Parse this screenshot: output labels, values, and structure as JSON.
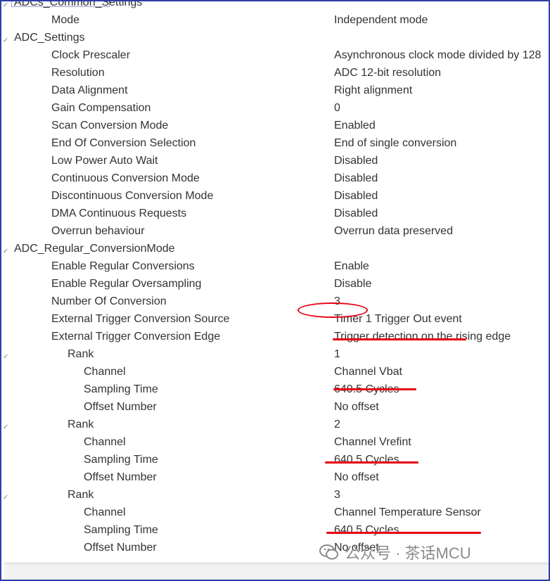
{
  "accent_colors": {
    "border": "#2f3fa8",
    "annotation": "#e60012"
  },
  "rows": [
    {
      "key": "ADCs_Common_Settings",
      "val": "",
      "level": 0,
      "chev": true
    },
    {
      "key": "Mode",
      "val": "Independent mode",
      "level": 1,
      "chev": false
    },
    {
      "key": "ADC_Settings",
      "val": "",
      "level": 0,
      "chev": true
    },
    {
      "key": "Clock Prescaler",
      "val": "Asynchronous clock mode divided by 128",
      "level": 1,
      "chev": false
    },
    {
      "key": "Resolution",
      "val": "ADC 12-bit resolution",
      "level": 1,
      "chev": false
    },
    {
      "key": "Data Alignment",
      "val": "Right alignment",
      "level": 1,
      "chev": false
    },
    {
      "key": "Gain Compensation",
      "val": "0",
      "level": 1,
      "chev": false
    },
    {
      "key": "Scan Conversion Mode",
      "val": "Enabled",
      "level": 1,
      "chev": false
    },
    {
      "key": "End Of Conversion Selection",
      "val": "End of single conversion",
      "level": 1,
      "chev": false
    },
    {
      "key": "Low Power Auto Wait",
      "val": "Disabled",
      "level": 1,
      "chev": false
    },
    {
      "key": "Continuous Conversion Mode",
      "val": "Disabled",
      "level": 1,
      "chev": false
    },
    {
      "key": "Discontinuous Conversion Mode",
      "val": "Disabled",
      "level": 1,
      "chev": false
    },
    {
      "key": "DMA Continuous Requests",
      "val": "Disabled",
      "level": 1,
      "chev": false
    },
    {
      "key": "Overrun behaviour",
      "val": "Overrun data preserved",
      "level": 1,
      "chev": false
    },
    {
      "key": "ADC_Regular_ConversionMode",
      "val": "",
      "level": 0,
      "chev": true
    },
    {
      "key": "Enable Regular Conversions",
      "val": "Enable",
      "level": 1,
      "chev": false
    },
    {
      "key": "Enable Regular Oversampling",
      "val": "Disable",
      "level": 1,
      "chev": false
    },
    {
      "key": "Number Of Conversion",
      "val": "3",
      "level": 1,
      "chev": false
    },
    {
      "key": "External Trigger Conversion Source",
      "val": "Timer 1 Trigger Out event",
      "level": 1,
      "chev": false
    },
    {
      "key": "External Trigger Conversion Edge",
      "val": "Trigger detection on the rising edge",
      "level": 1,
      "chev": false
    },
    {
      "key": "Rank",
      "val": "1",
      "level": 2,
      "chev": true
    },
    {
      "key": "Channel",
      "val": "Channel Vbat",
      "level": 3,
      "chev": false
    },
    {
      "key": "Sampling Time",
      "val": "640.5 Cycles",
      "level": 3,
      "chev": false
    },
    {
      "key": "Offset Number",
      "val": "No offset",
      "level": 3,
      "chev": false
    },
    {
      "key": "Rank",
      "val": "2",
      "level": 2,
      "chev": true
    },
    {
      "key": "Channel",
      "val": "Channel Vrefint",
      "level": 3,
      "chev": false
    },
    {
      "key": "Sampling Time",
      "val": "640.5 Cycles",
      "level": 3,
      "chev": false
    },
    {
      "key": "Offset Number",
      "val": "No offset",
      "level": 3,
      "chev": false
    },
    {
      "key": "Rank",
      "val": "3",
      "level": 2,
      "chev": true
    },
    {
      "key": "Channel",
      "val": "Channel Temperature Sensor",
      "level": 3,
      "chev": false
    },
    {
      "key": "Sampling Time",
      "val": "640.5 Cycles",
      "level": 3,
      "chev": false
    },
    {
      "key": "Offset Number",
      "val": "No offset",
      "level": 3,
      "chev": false
    }
  ],
  "watermark": {
    "text": "公众号 · 茶话MCU",
    "icon": "wechat-logo"
  }
}
